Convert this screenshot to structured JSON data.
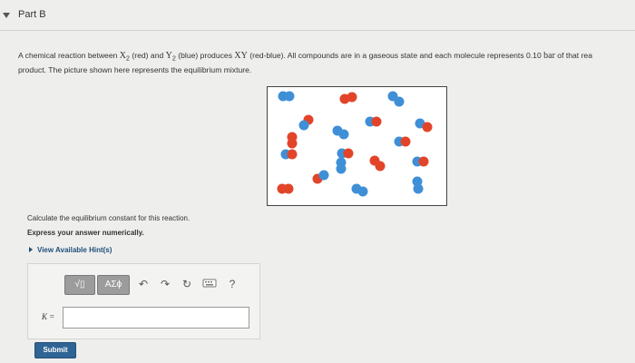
{
  "part": {
    "title": "Part B"
  },
  "problem": {
    "t1": "A chemical reaction between ",
    "r_x": "X",
    "r_x_sub": "2",
    "t2": " (red) and ",
    "r_y": "Y",
    "r_y_sub": "2",
    "t3": " (blue) produces ",
    "r_xy": "XY",
    "t4": " (red-blue). All compounds are in a gaseous state and each molecule represents 0.10 ",
    "unit": "bar",
    "t5": " of that rea",
    "line2": "product. The picture shown here represents the equilibrium mixture."
  },
  "colors": {
    "red": "#e2442a",
    "blue": "#3f8fd6"
  },
  "instructions": {
    "calculate": "Calculate the equilibrium constant for this reaction.",
    "express": "Express your answer numerically."
  },
  "hint": {
    "label": "View Available Hint(s)"
  },
  "toolbar": {
    "templates_label": "√▯",
    "symbols_label": "AΣϕ",
    "undo_icon": "undo-icon",
    "redo_icon": "redo-icon",
    "reset_icon": "reset-icon",
    "keyboard_icon": "keyboard-icon",
    "help_label": "?"
  },
  "answer": {
    "label": "K =",
    "value": ""
  },
  "submit": {
    "label": "Submit"
  }
}
